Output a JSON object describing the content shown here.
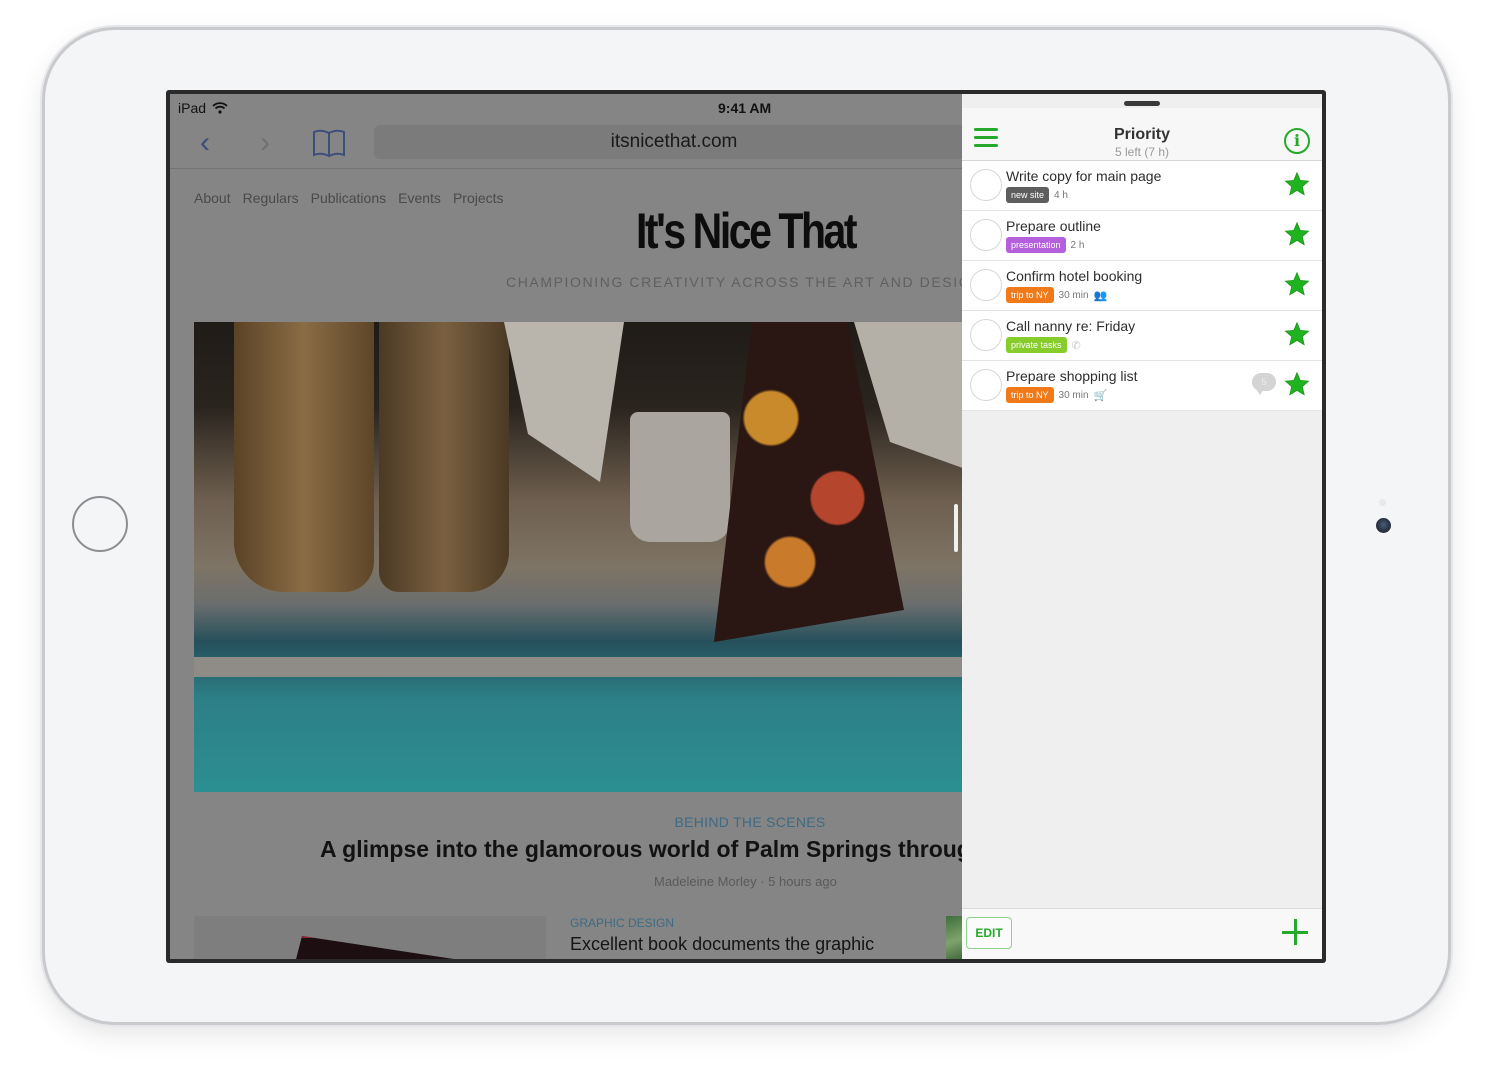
{
  "status_bar": {
    "device": "iPad",
    "time": "9:41 AM",
    "wifi_icon": "wifi-icon"
  },
  "safari": {
    "back_icon": "chevron-left-icon",
    "forward_icon": "chevron-right-icon",
    "bookmarks_icon": "book-icon",
    "url": "itsnicethat.com",
    "site_nav": [
      "About",
      "Regulars",
      "Publications",
      "Events",
      "Projects"
    ],
    "logo": "It's Nice That",
    "tagline": "CHAMPIONING CREATIVITY ACROSS THE ART AND DESIGN WOR",
    "featured": {
      "category": "BEHIND THE SCENES",
      "headline": "A glimpse into the glamorous world of Palm Springs through",
      "byline": "Madeleine Morley · 5 hours ago"
    },
    "second_article": {
      "category": "GRAPHIC DESIGN",
      "headline": "Excellent book documents the graphic"
    }
  },
  "tasks_app": {
    "title": "Priority",
    "subtitle": "5 left (7 h)",
    "menu_icon": "hamburger-menu-icon",
    "info_icon": "info-icon",
    "accent_color": "#25a92a",
    "tasks": [
      {
        "title": "Write copy for main page",
        "tag": "new site",
        "tag_color": "#5e5e5e",
        "duration": "4 h",
        "extra_icon": "",
        "comment_count": "",
        "starred": true
      },
      {
        "title": "Prepare outline",
        "tag": "presentation",
        "tag_color": "#b45fdc",
        "duration": "2 h",
        "extra_icon": "",
        "comment_count": "",
        "starred": true
      },
      {
        "title": "Confirm hotel booking",
        "tag": "trip to NY",
        "tag_color": "#f07a1a",
        "duration": "30 min",
        "extra_icon": "people-icon",
        "comment_count": "",
        "starred": true
      },
      {
        "title": "Call nanny re: Friday",
        "tag": "private tasks",
        "tag_color": "#86cc2a",
        "duration": "",
        "extra_icon": "phone-icon",
        "comment_count": "",
        "starred": true
      },
      {
        "title": "Prepare shopping list",
        "tag": "trip to NY",
        "tag_color": "#f07a1a",
        "duration": "30 min",
        "extra_icon": "cart-icon",
        "comment_count": "5",
        "starred": true
      }
    ],
    "footer": {
      "edit_label": "EDIT",
      "add_icon": "plus-icon"
    }
  }
}
